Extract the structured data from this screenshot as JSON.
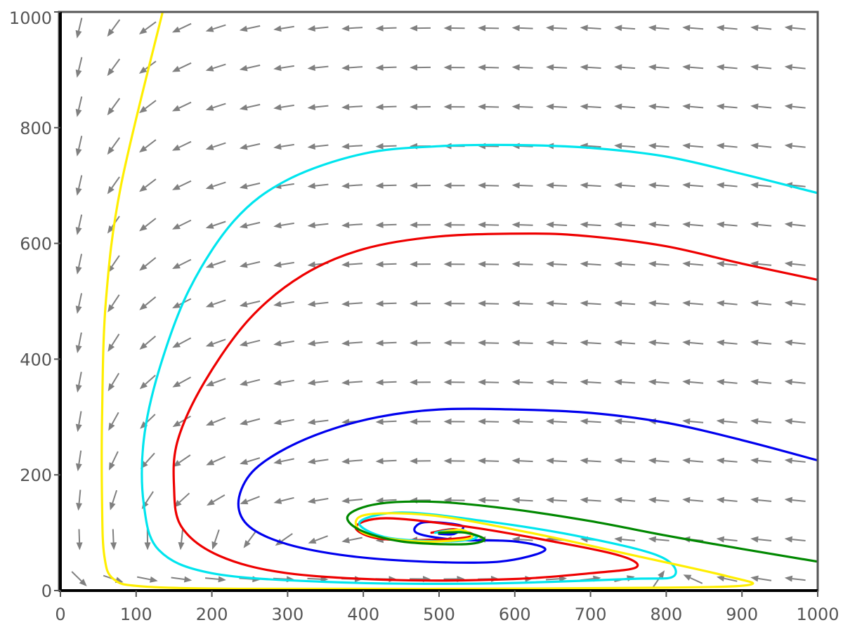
{
  "chart_data": {
    "type": "line",
    "subtype": "phase portrait with direction field",
    "title": "",
    "xlabel": "",
    "ylabel": "",
    "xlim": [
      0,
      1000
    ],
    "ylim": [
      0,
      1000
    ],
    "x_ticks": [
      0,
      100,
      200,
      300,
      400,
      500,
      600,
      700,
      800,
      900,
      1000
    ],
    "y_ticks": [
      0,
      200,
      400,
      600,
      800,
      1000
    ],
    "x_tick_labels": [
      "0",
      "100",
      "200",
      "300",
      "400",
      "500",
      "600",
      "700",
      "800",
      "900",
      "1000"
    ],
    "y_tick_labels": [
      "0",
      "200",
      "400",
      "600",
      "800",
      "1000"
    ],
    "grid": false,
    "legend": "none",
    "arrow_color": "#808080",
    "frame_color": "#555555",
    "axis_line_color": "#000000",
    "equilibrium": {
      "x": 500,
      "y": 100
    },
    "direction_field": {
      "equations": "dx/dt = x*(1 - x/1000) - x*y/100 ; dy/dt = -y + y*x/500",
      "x_points": [
        25,
        70,
        115,
        160,
        205,
        250,
        295,
        340,
        385,
        430,
        475,
        520,
        565,
        610,
        655,
        700,
        745,
        790,
        835,
        880,
        925,
        970
      ],
      "y_points": [
        20,
        88,
        156,
        224,
        292,
        360,
        428,
        496,
        564,
        632,
        700,
        768,
        836,
        904,
        972
      ]
    },
    "series": [
      {
        "color": "#0000ee",
        "values": [
          [
            1000,
            225
          ],
          [
            900,
            260
          ],
          [
            800,
            290
          ],
          [
            700,
            307
          ],
          [
            600,
            313
          ],
          [
            500,
            313
          ],
          [
            420,
            300
          ],
          [
            350,
            275
          ],
          [
            290,
            240
          ],
          [
            250,
            200
          ],
          [
            235,
            150
          ],
          [
            250,
            110
          ],
          [
            300,
            80
          ],
          [
            380,
            60
          ],
          [
            480,
            50
          ],
          [
            580,
            50
          ],
          [
            640,
            70
          ],
          [
            600,
            85
          ],
          [
            520,
            88
          ],
          [
            470,
            100
          ],
          [
            480,
            118
          ],
          [
            530,
            112
          ],
          [
            520,
            98
          ],
          [
            500,
            98
          ]
        ]
      },
      {
        "color": "#ee0000",
        "values": [
          [
            1000,
            537
          ],
          [
            900,
            565
          ],
          [
            800,
            595
          ],
          [
            700,
            612
          ],
          [
            620,
            617
          ],
          [
            500,
            612
          ],
          [
            400,
            590
          ],
          [
            320,
            545
          ],
          [
            250,
            470
          ],
          [
            190,
            360
          ],
          [
            155,
            260
          ],
          [
            150,
            180
          ],
          [
            160,
            110
          ],
          [
            210,
            60
          ],
          [
            300,
            30
          ],
          [
            450,
            18
          ],
          [
            600,
            20
          ],
          [
            700,
            30
          ],
          [
            760,
            40
          ],
          [
            740,
            60
          ],
          [
            650,
            85
          ],
          [
            540,
            110
          ],
          [
            430,
            125
          ],
          [
            390,
            110
          ],
          [
            420,
            90
          ],
          [
            500,
            88
          ],
          [
            545,
            95
          ],
          [
            520,
            106
          ],
          [
            490,
            100
          ]
        ]
      },
      {
        "color": "#00e5ee",
        "values": [
          [
            1000,
            687
          ],
          [
            900,
            720
          ],
          [
            800,
            750
          ],
          [
            700,
            765
          ],
          [
            600,
            770
          ],
          [
            500,
            768
          ],
          [
            400,
            755
          ],
          [
            300,
            710
          ],
          [
            230,
            640
          ],
          [
            170,
            520
          ],
          [
            130,
            380
          ],
          [
            110,
            260
          ],
          [
            110,
            150
          ],
          [
            130,
            70
          ],
          [
            200,
            30
          ],
          [
            350,
            15
          ],
          [
            550,
            12
          ],
          [
            750,
            20
          ],
          [
            810,
            25
          ],
          [
            790,
            60
          ],
          [
            680,
            95
          ],
          [
            560,
            120
          ],
          [
            450,
            135
          ],
          [
            395,
            118
          ],
          [
            430,
            92
          ],
          [
            510,
            85
          ],
          [
            550,
            92
          ],
          [
            520,
            104
          ],
          [
            495,
            100
          ]
        ]
      },
      {
        "color": "#ffee00",
        "values": [
          [
            135,
            1000
          ],
          [
            80,
            700
          ],
          [
            60,
            500
          ],
          [
            55,
            300
          ],
          [
            55,
            150
          ],
          [
            58,
            60
          ],
          [
            70,
            20
          ],
          [
            110,
            7
          ],
          [
            250,
            3
          ],
          [
            500,
            3
          ],
          [
            800,
            5
          ],
          [
            910,
            10
          ],
          [
            880,
            25
          ],
          [
            760,
            60
          ],
          [
            620,
            100
          ],
          [
            490,
            130
          ],
          [
            400,
            130
          ],
          [
            400,
            100
          ],
          [
            470,
            85
          ],
          [
            540,
            90
          ],
          [
            530,
            105
          ],
          [
            500,
            100
          ]
        ]
      },
      {
        "color": "#008800",
        "values": [
          [
            1000,
            50
          ],
          [
            900,
            72
          ],
          [
            800,
            95
          ],
          [
            700,
            120
          ],
          [
            600,
            140
          ],
          [
            500,
            153
          ],
          [
            420,
            150
          ],
          [
            380,
            130
          ],
          [
            395,
            105
          ],
          [
            450,
            85
          ],
          [
            530,
            80
          ],
          [
            560,
            88
          ],
          [
            535,
            100
          ],
          [
            500,
            100
          ]
        ]
      }
    ]
  }
}
